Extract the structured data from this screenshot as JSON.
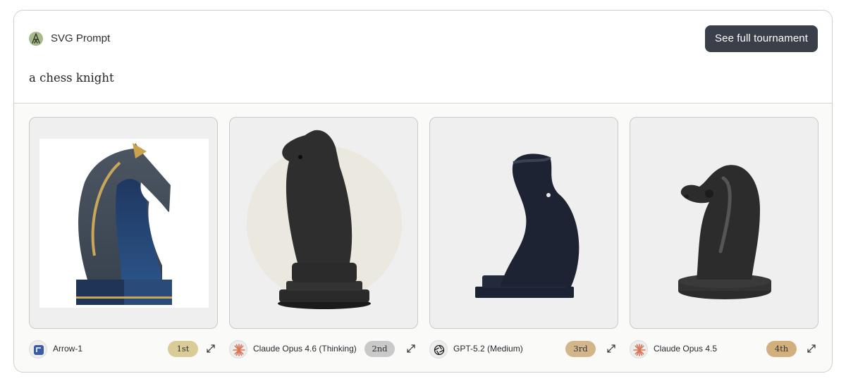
{
  "header": {
    "brand_label": "SVG Prompt",
    "tournament_button": "See full tournament",
    "prompt": "a chess knight"
  },
  "entries": [
    {
      "model": "Arrow-1",
      "rank": "1st",
      "rank_color": "#d9cc97",
      "icon": "arrow-logo-icon"
    },
    {
      "model": "Claude Opus 4.6 (Thinking)",
      "rank": "2nd",
      "rank_color": "#c9c9c9",
      "icon": "claude-starburst-icon"
    },
    {
      "model": "GPT-5.2 (Medium)",
      "rank": "3rd",
      "rank_color": "#d3b58c",
      "icon": "openai-logo-icon"
    },
    {
      "model": "Claude Opus 4.5",
      "rank": "4th",
      "rank_color": "#d2b07d",
      "icon": "claude-starburst-icon"
    }
  ],
  "colors": {
    "button_bg": "#3b3f4a",
    "panel_bg": "#efefef",
    "claude_orange": "#d97757"
  }
}
